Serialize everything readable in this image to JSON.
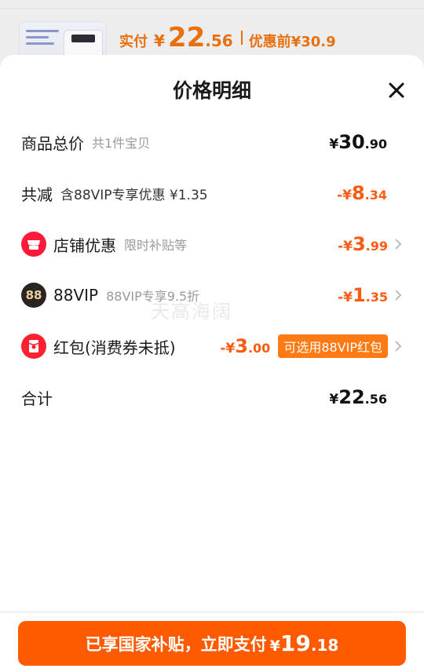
{
  "background": {
    "price_label": "实付",
    "currency": "¥",
    "price_int": "22",
    "price_dec": ".56",
    "original_label": "优惠前",
    "original_price": "¥30.9"
  },
  "sheet": {
    "title": "价格明细",
    "close_icon": "close-icon"
  },
  "rows": {
    "total": {
      "label": "商品总价",
      "sub": "共1件宝贝",
      "currency": "¥",
      "int": "30",
      "dec": ".90"
    },
    "reduction": {
      "label": "共减",
      "sub": "含88VIP专享优惠 ¥1.35",
      "currency": "-¥",
      "int": "8",
      "dec": ".34"
    },
    "shop": {
      "label": "店铺优惠",
      "sub": "限时补贴等",
      "currency": "-¥",
      "int": "3",
      "dec": ".99",
      "icon": "shop-icon"
    },
    "vip": {
      "label": "88VIP",
      "sub": "88VIP专享9.5折",
      "currency": "-¥",
      "int": "1",
      "dec": ".35",
      "icon": "vip-icon",
      "icon_text": "88"
    },
    "hongbao": {
      "label": "红包(消费券未抵)",
      "currency": "-¥",
      "int": "3",
      "dec": ".00",
      "badge": "可选用88VIP红包",
      "icon": "red-packet-icon"
    },
    "sum": {
      "label": "合计",
      "currency": "¥",
      "int": "22",
      "dec": ".56"
    }
  },
  "watermark": "天高海阔",
  "pay": {
    "label": "已享国家补贴，立即支付",
    "currency": "¥",
    "int": "19",
    "dec": ".18"
  },
  "colors": {
    "accent": "#ff5a00",
    "discount": "#ff5a12",
    "badge": "#ff7a12"
  }
}
